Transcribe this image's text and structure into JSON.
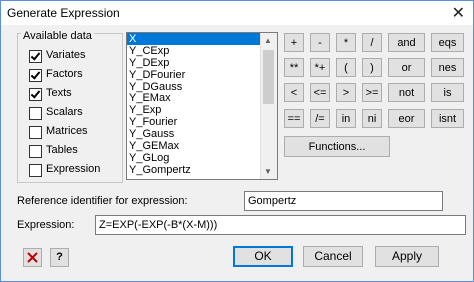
{
  "window": {
    "title": "Generate Expression",
    "close_glyph": "✕"
  },
  "available_data": {
    "legend": "Available data",
    "items": [
      {
        "label": "Variates",
        "checked": true
      },
      {
        "label": "Factors",
        "checked": true
      },
      {
        "label": "Texts",
        "checked": true
      },
      {
        "label": "Scalars",
        "checked": false
      },
      {
        "label": "Matrices",
        "checked": false
      },
      {
        "label": "Tables",
        "checked": false
      },
      {
        "label": "Expression",
        "checked": false
      }
    ]
  },
  "list": {
    "items": [
      "X",
      "Y_CExp",
      "Y_DExp",
      "Y_DFourier",
      "Y_DGauss",
      "Y_EMax",
      "Y_Exp",
      "Y_Fourier",
      "Y_Gauss",
      "Y_GEMax",
      "Y_GLog",
      "Y_Gompertz"
    ],
    "selected": "X"
  },
  "operators": {
    "row1": [
      "+",
      "-",
      "*",
      "/",
      "and",
      "eqs"
    ],
    "row2": [
      "**",
      "*+",
      "(",
      ")",
      "or",
      "nes"
    ],
    "row3": [
      "<",
      "<=",
      ">",
      ">=",
      "not",
      "is"
    ],
    "row4": [
      "==",
      "/=",
      "in",
      "ni",
      "eor",
      "isnt"
    ],
    "functions_label": "Functions..."
  },
  "reference": {
    "label": "Reference identifier for expression:",
    "value": "Gompertz"
  },
  "expression": {
    "label": "Expression:",
    "value": "Z=EXP(-EXP(-B*(X-M)))"
  },
  "footer": {
    "ok": "OK",
    "cancel": "Cancel",
    "apply": "Apply",
    "help_glyph": "?"
  },
  "colors": {
    "selection": "#0078d7",
    "clear_icon": "#c00000"
  },
  "icons": {
    "clear": "red-x-icon",
    "help": "help-icon"
  }
}
